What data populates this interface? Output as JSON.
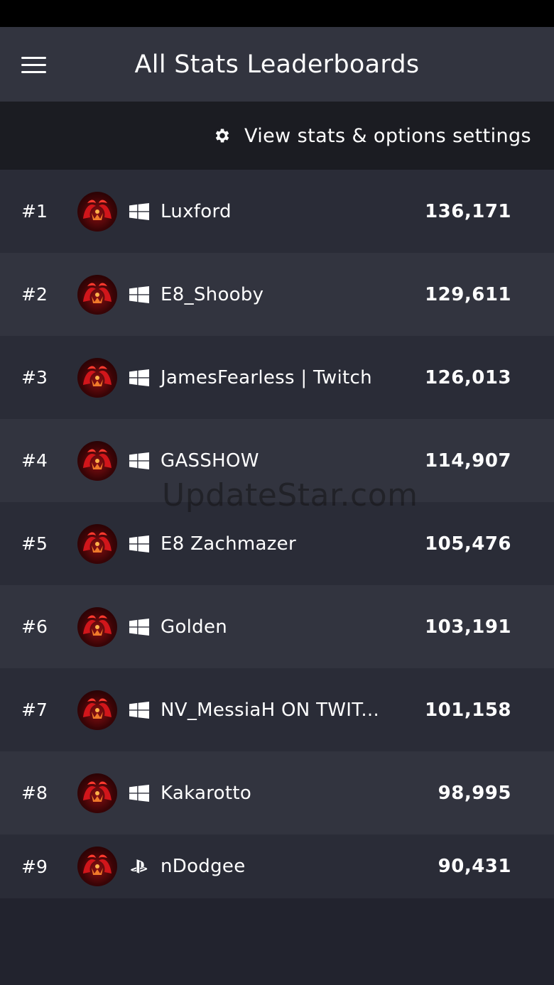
{
  "header": {
    "title": "All Stats Leaderboards",
    "menu_icon": "hamburger-menu-icon"
  },
  "settings": {
    "label": "View stats & options settings",
    "icon": "gear-icon"
  },
  "watermark": "UpdateStar.com",
  "leaderboard": [
    {
      "rank": "#1",
      "platform": "windows",
      "name": "Luxford",
      "score": "136,171"
    },
    {
      "rank": "#2",
      "platform": "windows",
      "name": "E8_Shooby",
      "score": "129,611"
    },
    {
      "rank": "#3",
      "platform": "windows",
      "name": "JamesFearless | Twitch",
      "score": "126,013"
    },
    {
      "rank": "#4",
      "platform": "windows",
      "name": "GASSHOW",
      "score": "114,907"
    },
    {
      "rank": "#5",
      "platform": "windows",
      "name": "E8 Zachmazer",
      "score": "105,476"
    },
    {
      "rank": "#6",
      "platform": "windows",
      "name": "Golden",
      "score": "103,191"
    },
    {
      "rank": "#7",
      "platform": "windows",
      "name": "NV_MessiaH ON TWIT...",
      "score": "101,158"
    },
    {
      "rank": "#8",
      "platform": "windows",
      "name": "Kakarotto",
      "score": "98,995"
    },
    {
      "rank": "#9",
      "platform": "playstation",
      "name": "nDodgee",
      "score": "90,431"
    }
  ],
  "colors": {
    "header_bg": "#32343f",
    "settings_bg": "#1b1c22",
    "row_a": "#2a2c37",
    "row_b": "#32343f"
  }
}
